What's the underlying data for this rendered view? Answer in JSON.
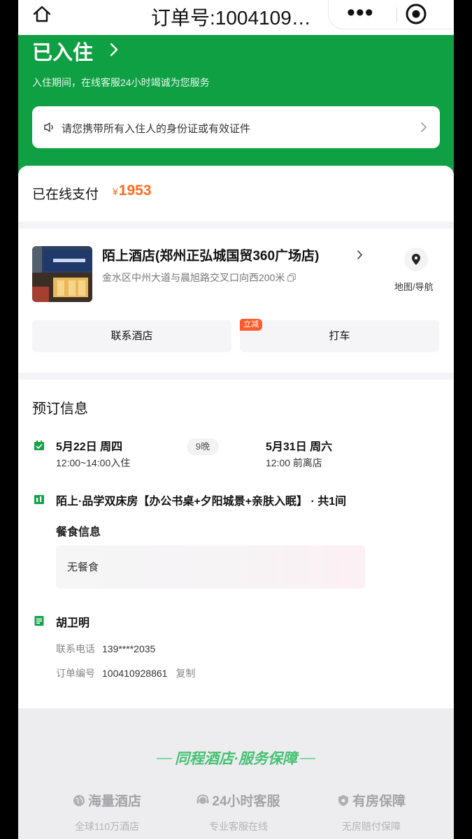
{
  "navbar": {
    "title": "订单号:1004109…",
    "more_label": "•••"
  },
  "hero": {
    "status_title": "已入住",
    "subtitle": "入住期间，在线客服24小时竭诚为您服务",
    "notice": "请您携带所有入住人的身份证或有效证件"
  },
  "payment": {
    "label": "已在线支付",
    "currency": "¥",
    "amount": "1953"
  },
  "hotel": {
    "name": "陌上酒店(郑州正弘城国贸360广场店)",
    "address": "金水区中州大道与晨旭路交叉口向西200米",
    "map_label": "地图/导航",
    "contact_button": "联系酒店",
    "taxi_button": "打车",
    "taxi_badge": "立减"
  },
  "booking": {
    "title": "预订信息",
    "checkin_date": "5月22日  周四",
    "checkin_time": "12:00~14:00入住",
    "nights": "9晚",
    "checkout_date": "5月31日  周六",
    "checkout_time": "12:00 前离店",
    "room": "陌上·品学双床房【办公书桌+夕阳城景+亲肤入眠】 · 共1间",
    "meal_title": "餐食信息",
    "meal_value": "无餐食",
    "guest_name": "胡卫明",
    "phone_label": "联系电话",
    "phone_value": "139****2035",
    "order_label": "订单编号",
    "order_value": "100410928861",
    "copy_label": "复制"
  },
  "footer": {
    "brand": "同程酒店·服务保障",
    "guarantees": [
      {
        "title": "海量酒店",
        "sub": "全球110万酒店",
        "icon": "globe-icon"
      },
      {
        "title": "24小时客服",
        "sub": "专业客服在线",
        "icon": "headset-icon"
      },
      {
        "title": "有房保障",
        "sub": "无房赔付保障",
        "icon": "shield-icon"
      }
    ]
  },
  "colors": {
    "brand_green": "#0fa043",
    "price_orange": "#ff6a1a",
    "promo_red": "#ff5a2b"
  }
}
